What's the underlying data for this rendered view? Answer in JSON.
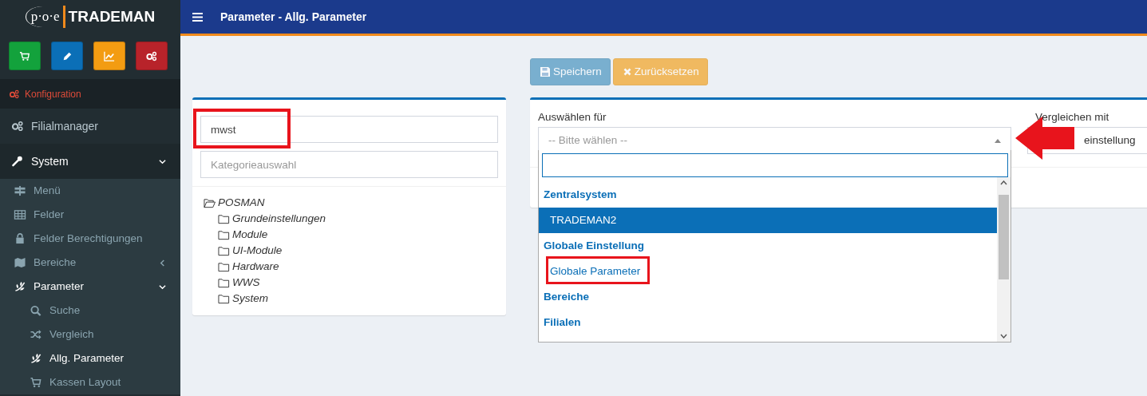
{
  "logo": {
    "prefix": "p·o·e",
    "name": "TRADEMAN"
  },
  "quick_buttons": [
    {
      "color": "#13a23c"
    },
    {
      "color": "#0b6fb7"
    },
    {
      "color": "#f39c12"
    },
    {
      "color": "#b8232a"
    }
  ],
  "sidebar": {
    "section_header": "Konfiguration",
    "items": [
      {
        "label": "Filialmanager",
        "selected": false
      },
      {
        "label": "System",
        "selected": true,
        "expanded": true,
        "children": [
          {
            "label": "Menü",
            "selected": false
          },
          {
            "label": "Felder",
            "selected": false
          },
          {
            "label": "Felder Berechtigungen",
            "selected": false
          },
          {
            "label": "Bereiche",
            "selected": false,
            "expanded": false
          },
          {
            "label": "Parameter",
            "selected": true,
            "expanded": true,
            "children": [
              {
                "label": "Suche",
                "selected": false
              },
              {
                "label": "Vergleich",
                "selected": false
              },
              {
                "label": "Allg. Parameter",
                "selected": true
              },
              {
                "label": "Kassen Layout",
                "selected": false
              }
            ]
          }
        ]
      }
    ]
  },
  "header": {
    "title": "Parameter - Allg. Parameter"
  },
  "toolbar": {
    "buttons": [
      {
        "label": "Speichern",
        "kind": "save",
        "disabled": true
      },
      {
        "label": "Zurücksetzen",
        "kind": "reset",
        "disabled": true
      }
    ]
  },
  "filter_panel": {
    "search": {
      "value": "mwst"
    },
    "category": {
      "placeholder": "Kategorieauswahl"
    },
    "tree": [
      {
        "label": "POSMAN",
        "expanded": true,
        "children": [
          {
            "label": "Grundeinstellungen",
            "expanded": false
          },
          {
            "label": "Module",
            "expanded": false
          },
          {
            "label": "UI-Module",
            "expanded": false
          },
          {
            "label": "Hardware",
            "expanded": false
          },
          {
            "label": "WWS",
            "expanded": false
          },
          {
            "label": "System",
            "expanded": false
          }
        ]
      }
    ]
  },
  "selection_panel": {
    "select_for": {
      "label": "Auswählen für",
      "placeholder": "-- Bitte wählen --",
      "expanded": true,
      "options": [
        {
          "text": "Zentralsystem",
          "kind": "group",
          "selected": false
        },
        {
          "text": "TRADEMAN2",
          "kind": "option",
          "selected": true
        },
        {
          "text": "Globale Einstellung",
          "kind": "group",
          "selected": false
        },
        {
          "text": "Globale Parameter",
          "kind": "option",
          "selected": false
        },
        {
          "text": "Bereiche",
          "kind": "group",
          "selected": false
        },
        {
          "text": "Filialen",
          "kind": "group",
          "selected": false
        }
      ]
    },
    "compare_with": {
      "label": "Vergleichen mit",
      "value": "einstellung"
    }
  }
}
